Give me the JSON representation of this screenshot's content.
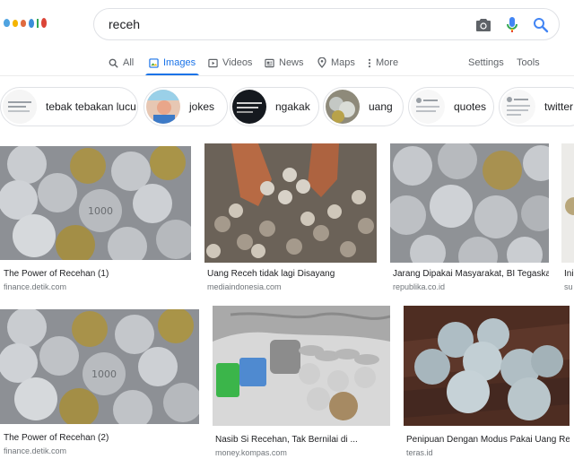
{
  "search": {
    "query": "receh"
  },
  "tabs": [
    {
      "label": "All",
      "icon": "search-icon"
    },
    {
      "label": "Images",
      "icon": "image-icon"
    },
    {
      "label": "Videos",
      "icon": "video-icon"
    },
    {
      "label": "News",
      "icon": "news-icon"
    },
    {
      "label": "Maps",
      "icon": "map-pin-icon"
    },
    {
      "label": "More",
      "icon": "more-vertical-icon"
    }
  ],
  "tools": {
    "settings": "Settings",
    "tools": "Tools"
  },
  "chips": [
    {
      "label": "tebak tebakan lucu"
    },
    {
      "label": "jokes"
    },
    {
      "label": "ngakak"
    },
    {
      "label": "uang"
    },
    {
      "label": "quotes"
    },
    {
      "label": "twitter"
    }
  ],
  "results": [
    {
      "caption": "The Power of Recehan (1)",
      "source": "finance.detik.com"
    },
    {
      "caption": "Uang Receh tidak lagi Disayang",
      "source": "mediaindonesia.com"
    },
    {
      "caption": "Jarang Dipakai Masyarakat, BI Tegaska...",
      "source": "republika.co.id"
    },
    {
      "caption": "Ini",
      "source": "su"
    },
    {
      "caption": "The Power of Recehan (2)",
      "source": "finance.detik.com"
    },
    {
      "caption": "Nasib Si Recehan, Tak Bernilai di ...",
      "source": "money.kompas.com"
    },
    {
      "caption": "Penipuan Dengan Modus Pakai Uang Rec...",
      "source": "teras.id"
    }
  ],
  "colors": {
    "accent": "#1a73e8",
    "text": "#202124",
    "muted": "#5f6368",
    "source": "#70757a",
    "border": "#dfe1e5"
  }
}
